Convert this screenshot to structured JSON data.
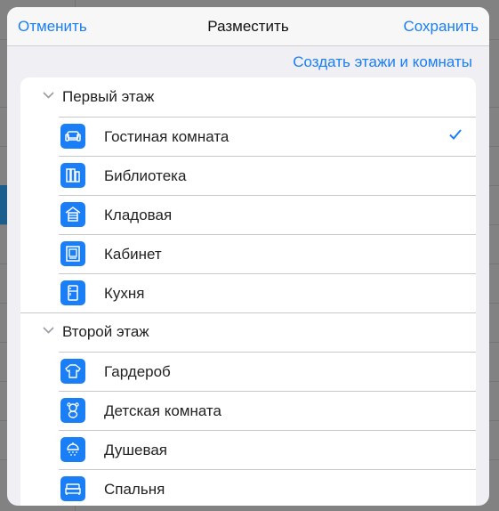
{
  "dialog": {
    "title": "Разместить",
    "cancel_label": "Отменить",
    "save_label": "Сохранить",
    "create_link": "Создать этажи и комнаты"
  },
  "sections": [
    {
      "title": "Первый этаж",
      "rooms": [
        {
          "label": "Гостиная комната",
          "icon": "sofa-icon",
          "selected": true
        },
        {
          "label": "Библиотека",
          "icon": "books-icon",
          "selected": false
        },
        {
          "label": "Кладовая",
          "icon": "storage-icon",
          "selected": false
        },
        {
          "label": "Кабинет",
          "icon": "office-icon",
          "selected": false
        },
        {
          "label": "Кухня",
          "icon": "fridge-icon",
          "selected": false
        }
      ]
    },
    {
      "title": "Второй этаж",
      "rooms": [
        {
          "label": "Гардероб",
          "icon": "shirt-icon",
          "selected": false
        },
        {
          "label": "Детская комната",
          "icon": "teddy-bear-icon",
          "selected": false
        },
        {
          "label": "Душевая",
          "icon": "shower-icon",
          "selected": false
        },
        {
          "label": "Спальня",
          "icon": "bed-icon",
          "selected": false
        }
      ]
    }
  ],
  "colors": {
    "accent": "#1a7ef6",
    "background": "#efeff4",
    "card": "#ffffff"
  }
}
